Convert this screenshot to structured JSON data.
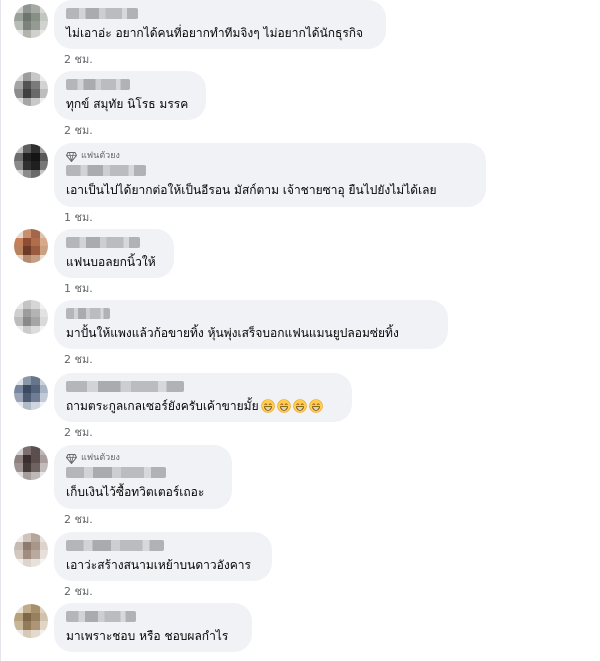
{
  "comments": [
    {
      "text": "ไม่เอาอ่ะ อยากได้คนที่อยากทำทีมจิงๆ ไม่อยากได้นักธุรกิจ",
      "time": "2 ชม.",
      "fan_badge": "",
      "emoji_count": 0
    },
    {
      "text": "ทุกข์ สมุทัย นิโรธ มรรค",
      "time": "2 ชม.",
      "fan_badge": "",
      "emoji_count": 0
    },
    {
      "text": "เอาเป็นไปได้ยากต่อให้เป็นอีรอน มัสก์ตาม เจ้าชายซาอุ ยืนไปยังไม่ได้เลย",
      "time": "1 ชม.",
      "fan_badge": "แฟนตัวยง",
      "emoji_count": 0
    },
    {
      "text": "แฟนบอลยกนิ้วให้",
      "time": "1 ชม.",
      "fan_badge": "",
      "emoji_count": 0
    },
    {
      "text": "มาปั้นให้แพงแล้วก้อขายทิ้ง หุ้นพุ่งเสร็จบอกแฟนแมนยูปลอมซ่ยทิ้ง",
      "time": "2 ชม.",
      "fan_badge": "",
      "emoji_count": 0
    },
    {
      "text": "ถามตระกูลเกลเซอร์ยังครับเค้าขายมั้ย",
      "time": "2 ชม.",
      "fan_badge": "",
      "emoji_count": 4,
      "emoji": "grinning-face-emoji"
    },
    {
      "text": "เก็บเงินไว้ซื้อทวิตเตอร์เถอะ",
      "time": "2 ชม.",
      "fan_badge": "แฟนตัวยง",
      "emoji_count": 0
    },
    {
      "text": "เอาว่ะสร้างสนามเหย้าบนดาวอังคาร",
      "time": "2 ชม.",
      "fan_badge": "",
      "emoji_count": 0
    },
    {
      "text": "มาเพราะชอบ หรือ ชอบผลกำไร",
      "time": "",
      "fan_badge": "",
      "emoji_count": 0
    }
  ],
  "colors": {
    "bubble": "#f0f2f5",
    "meta_text": "#65676b",
    "body_text": "#050505",
    "emoji_face": "#ffcc4d"
  },
  "icons": {
    "fan_badge": "diamond-icon"
  }
}
